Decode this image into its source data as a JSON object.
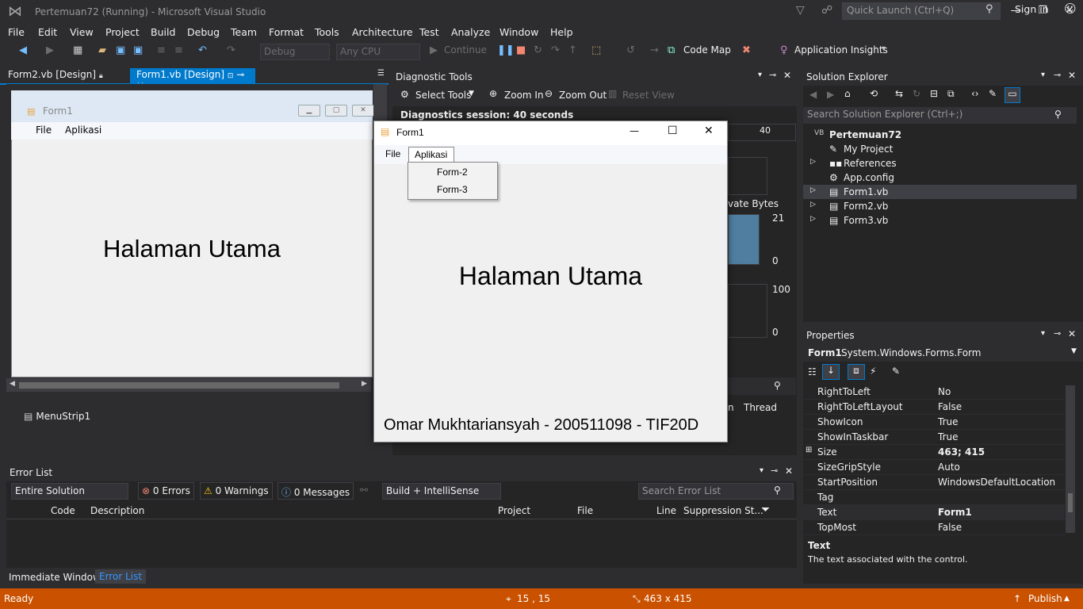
{
  "window": {
    "title": "Pertemuan72 (Running) - Microsoft Visual Studio",
    "quick_launch_placeholder": "Quick Launch (Ctrl+Q)",
    "sign_in": "Sign in"
  },
  "menu": [
    "File",
    "Edit",
    "View",
    "Project",
    "Build",
    "Debug",
    "Team",
    "Format",
    "Tools",
    "Architecture",
    "Test",
    "Analyze",
    "Window",
    "Help"
  ],
  "toolbar": {
    "config": "Debug",
    "platform": "Any CPU",
    "continue": "Continue",
    "code_map": "Code Map",
    "app_insights": "Application Insights"
  },
  "doc_tabs": {
    "tab1": "Form2.vb [Design]",
    "tab2": "Form1.vb [Design]"
  },
  "designer": {
    "form_caption": "Form1",
    "menu_file": "File",
    "menu_aplikasi": "Aplikasi",
    "heading": "Halaman Utama",
    "tray_item": "MenuStrip1"
  },
  "diagnostics": {
    "title": "Diagnostic Tools",
    "select_tools": "Select Tools",
    "zoom_in": "Zoom In",
    "zoom_out": "Zoom Out",
    "reset_view": "Reset View",
    "session": "Diagnostics session: 40 seconds",
    "tick_40": "40",
    "private_bytes": "vate Bytes",
    "mem_max": "21",
    "mem_min": "0",
    "cpu_max": "100",
    "cpu_min": "0",
    "col_n": "n",
    "col_thread": "Thread"
  },
  "running_form": {
    "caption": "Form1",
    "menu_file": "File",
    "menu_aplikasi": "Aplikasi",
    "dropdown": [
      "Form-2",
      "Form-3"
    ],
    "heading": "Halaman Utama",
    "footer": "Omar Mukhtariansyah - 200511098 - TIF20D"
  },
  "solution_explorer": {
    "title": "Solution Explorer",
    "search_placeholder": "Search Solution Explorer (Ctrl+;)",
    "items": [
      "Pertemuan72",
      "My Project",
      "References",
      "App.config",
      "Form1.vb",
      "Form2.vb",
      "Form3.vb"
    ]
  },
  "properties": {
    "title": "Properties",
    "object_name": "Form1",
    "object_type": "System.Windows.Forms.Form",
    "rows": [
      {
        "name": "RightToLeft",
        "value": "No"
      },
      {
        "name": "RightToLeftLayout",
        "value": "False"
      },
      {
        "name": "ShowIcon",
        "value": "True"
      },
      {
        "name": "ShowInTaskbar",
        "value": "True"
      },
      {
        "name": "Size",
        "value": "463; 415"
      },
      {
        "name": "SizeGripStyle",
        "value": "Auto"
      },
      {
        "name": "StartPosition",
        "value": "WindowsDefaultLocation"
      },
      {
        "name": "Tag",
        "value": ""
      },
      {
        "name": "Text",
        "value": "Form1"
      },
      {
        "name": "TopMost",
        "value": "False"
      }
    ],
    "desc_title": "Text",
    "desc_text": "The text associated with the control."
  },
  "error_list": {
    "title": "Error List",
    "scope": "Entire Solution",
    "errors": "0 Errors",
    "warnings": "0 Warnings",
    "messages": "0 Messages",
    "filter": "Build + IntelliSense",
    "search_placeholder": "Search Error List",
    "columns": [
      "Code",
      "Description",
      "Project",
      "File",
      "Line",
      "Suppression St..."
    ]
  },
  "bottom_tabs": [
    "Immediate Window",
    "Error List"
  ],
  "status": {
    "ready": "Ready",
    "position": "15 , 15",
    "size": "463 x 415",
    "publish": "Publish"
  },
  "colors": {
    "status_bar": "#ca5100",
    "accent": "#007acc"
  }
}
